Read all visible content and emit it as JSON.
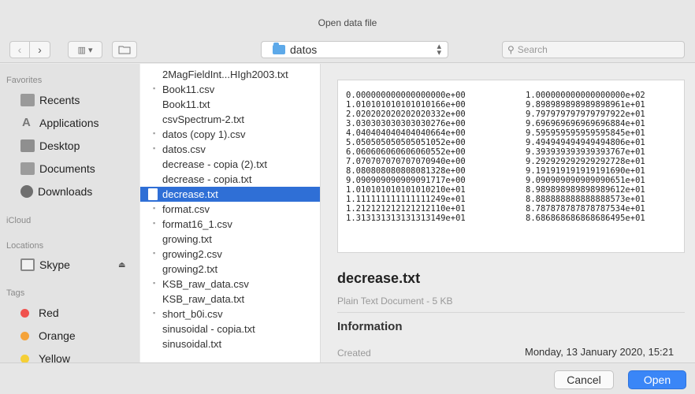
{
  "window": {
    "title": "Open data file"
  },
  "toolbar": {
    "back_icon": "‹",
    "forward_icon": "›",
    "view_icon": "▥ ▾",
    "location": "datos",
    "search_placeholder": "Search"
  },
  "sidebar": {
    "favorites_header": "Favorites",
    "favorites": [
      {
        "label": "Recents",
        "icon": "recents-icon"
      },
      {
        "label": "Applications",
        "icon": "applications-icon"
      },
      {
        "label": "Desktop",
        "icon": "desktop-icon"
      },
      {
        "label": "Documents",
        "icon": "documents-icon"
      },
      {
        "label": "Downloads",
        "icon": "downloads-icon"
      }
    ],
    "icloud_header": "iCloud",
    "locations_header": "Locations",
    "locations": [
      {
        "label": "Skype",
        "icon": "disk-icon"
      }
    ],
    "tags_header": "Tags",
    "tags": [
      {
        "label": "Red",
        "color": "#f0524e"
      },
      {
        "label": "Orange",
        "color": "#f5a33a"
      },
      {
        "label": "Yellow",
        "color": "#f5cf37"
      }
    ]
  },
  "files": [
    "2MagFieldInt...HIgh2003.txt",
    "Book11.csv",
    "Book11.txt",
    "csvSpectrum-2.txt",
    "datos (copy 1).csv",
    "datos.csv",
    "decrease - copia (2).txt",
    "decrease - copia.txt",
    "decrease.txt",
    "format.csv",
    "format16_1.csv",
    "growing.txt",
    "growing2.csv",
    "growing2.txt",
    "KSB_raw_data.csv",
    "KSB_raw_data.txt",
    "short_b0i.csv",
    "sinusoidal - copia.txt",
    "sinusoidal.txt"
  ],
  "selected_file_index": 8,
  "preview": {
    "rows": [
      [
        "0.000000000000000000e+00",
        "1.000000000000000000e+02"
      ],
      [
        "1.010101010101010166e+00",
        "9.898989898989898961e+01"
      ],
      [
        "2.020202020202020332e+00",
        "9.797979797979797922e+01"
      ],
      [
        "3.030303030303030276e+00",
        "9.696969696969696884e+01"
      ],
      [
        "4.040404040404040664e+00",
        "9.595959595959595845e+01"
      ],
      [
        "5.050505050505051052e+00",
        "9.494949494949494806e+01"
      ],
      [
        "6.060606060606060552e+00",
        "9.393939393939393767e+01"
      ],
      [
        "7.070707070707070940e+00",
        "9.292929292929292728e+01"
      ],
      [
        "8.080808080808081328e+00",
        "9.191919191919191690e+01"
      ],
      [
        "9.090909090909091717e+00",
        "9.090909090909090651e+01"
      ],
      [
        "1.010101010101010210e+01",
        "8.989898989898989612e+01"
      ],
      [
        "1.111111111111111249e+01",
        "8.888888888888888573e+01"
      ],
      [
        "1.212121212121212110e+01",
        "8.787878787878787534e+01"
      ],
      [
        "1.313131313131313149e+01",
        "8.686868686868686495e+01"
      ]
    ],
    "file_name": "decrease.txt",
    "file_kind": "Plain Text Document - 5 KB",
    "info_header": "Information",
    "created_label": "Created",
    "created_value": "Monday, 13 January 2020, 15:21"
  },
  "buttons": {
    "cancel": "Cancel",
    "open": "Open"
  }
}
